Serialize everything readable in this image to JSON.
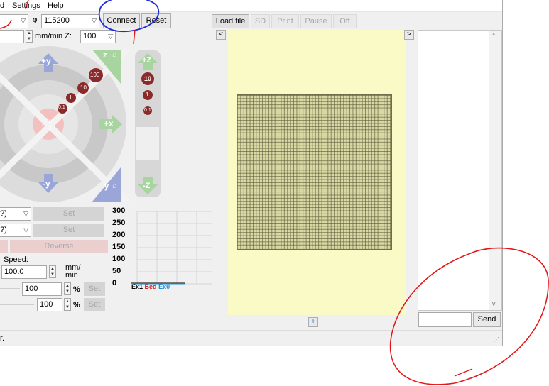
{
  "menu": {
    "partial_item": "d",
    "settings": "Settings",
    "help": "Help"
  },
  "toolbar": {
    "baud": "115200",
    "connect_label": "Connect",
    "reset_label": "Reset",
    "load_file_label": "Load file",
    "sd_label": "SD",
    "print_label": "Print",
    "pause_label": "Pause",
    "off_label": "Off"
  },
  "feedrate": {
    "xy_unit": "mm/min Z:",
    "z_value": "100"
  },
  "jog": {
    "plus_y": "+y",
    "minus_y": "-y",
    "plus_x": "+x",
    "steps": [
      "100",
      "10",
      "1",
      "0.1"
    ],
    "z_steps": [
      "10",
      "1",
      "0.1"
    ],
    "plus_z": "+Z",
    "minus_z": "-Z",
    "home_z": "z",
    "home_y": "y",
    "home_center_a": "y",
    "home_center_b": "x"
  },
  "temps": {
    "set_label": "Set",
    "reverse_label": "Reverse",
    "partial_a": "?)",
    "partial_b": "?)"
  },
  "speed": {
    "label": "Speed:",
    "value": "100.0",
    "unit_line1": "mm/",
    "unit_line2": "min",
    "feed_factor": "100",
    "flow_factor": "100",
    "percent": "%",
    "set_label": "Set"
  },
  "chart_data": {
    "type": "line",
    "y_ticks": [
      "300",
      "250",
      "200",
      "150",
      "100",
      "50",
      "0"
    ],
    "ylim": [
      0,
      300
    ],
    "legend": [
      {
        "name": "Ex1",
        "color": "#000000"
      },
      {
        "name": "Bed",
        "color": "#e02020"
      },
      {
        "name": "Ex0",
        "color": "#1a8fd6"
      }
    ]
  },
  "preview": {
    "left_arrow": "<",
    "right_arrow": ">",
    "plus": "+"
  },
  "console": {
    "send_label": "Send",
    "input_value": ""
  },
  "statusbar": {
    "text": "r."
  },
  "colors": {
    "annotation_red": "#e01818",
    "annotation_blue": "#1c2bd6",
    "preview_bg": "#fafac6"
  }
}
